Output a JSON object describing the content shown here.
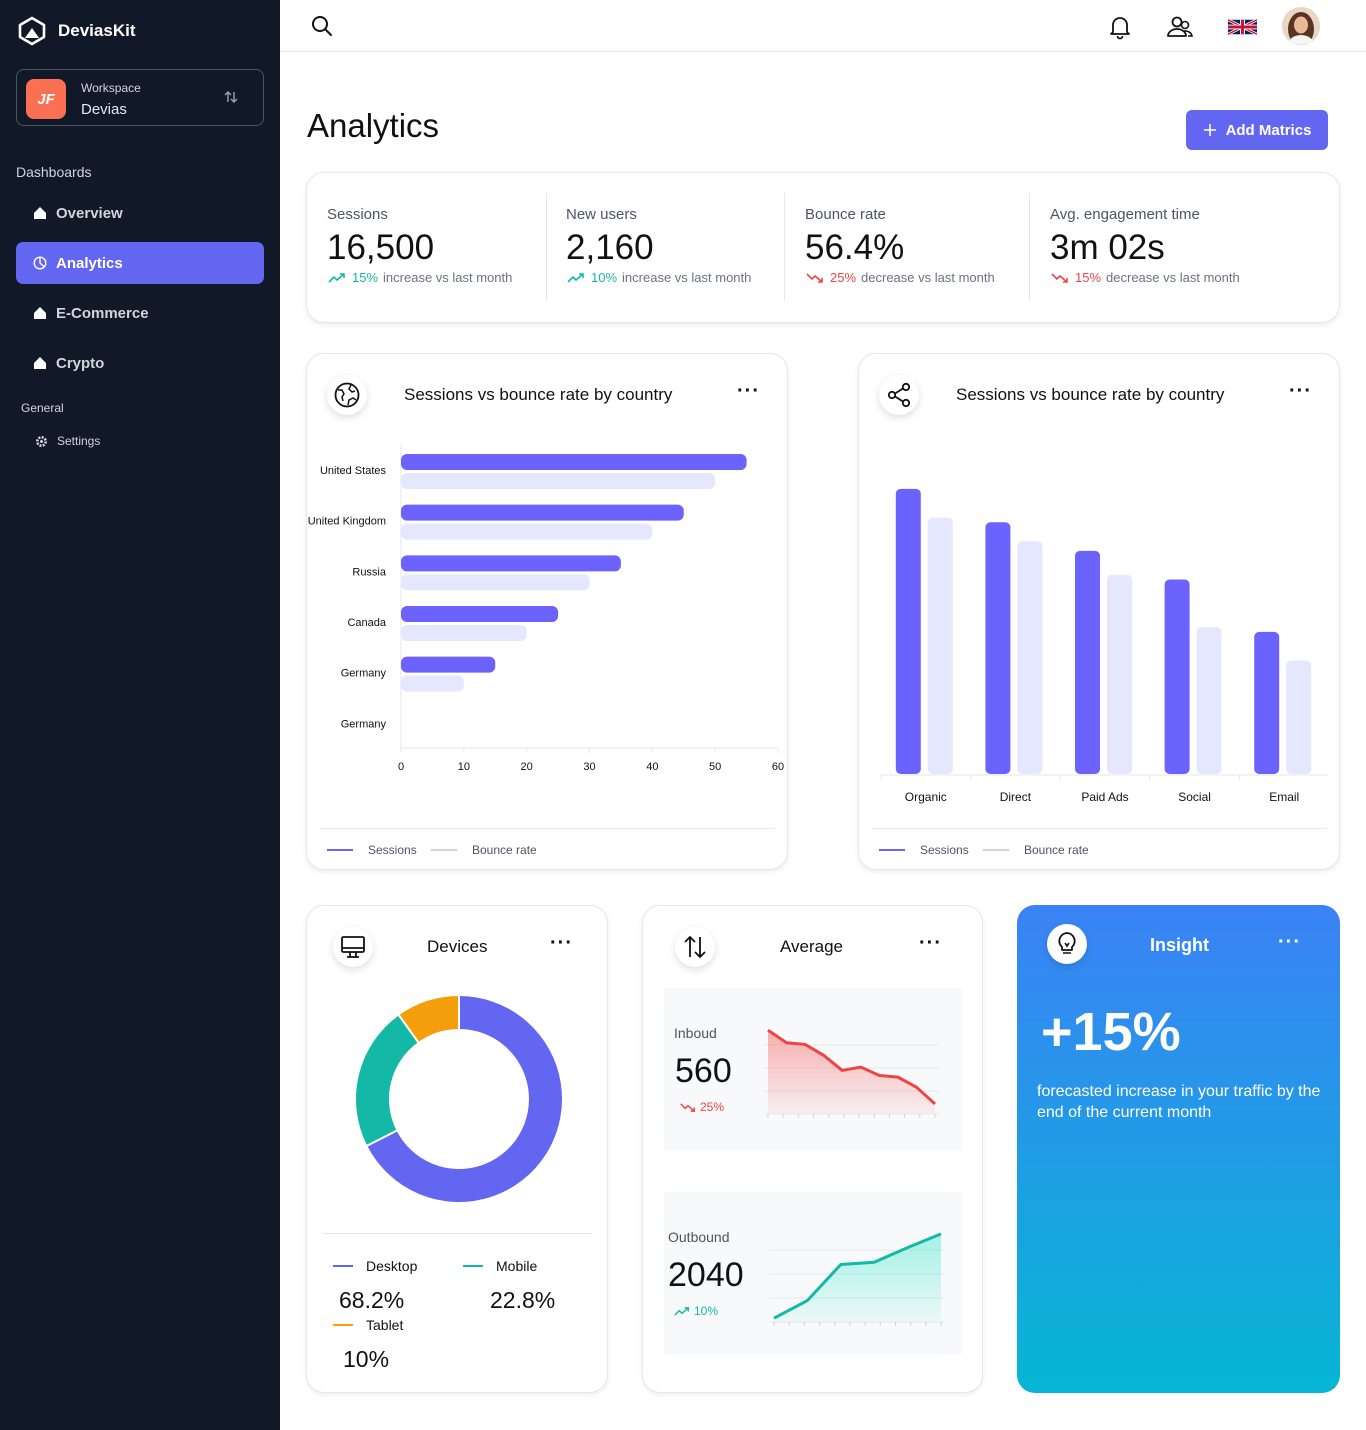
{
  "app": {
    "brand": "DeviasKit"
  },
  "workspace": {
    "label": "Workspace",
    "name": "Devias",
    "logo_text": "JF"
  },
  "sidebar": {
    "section_dashboards": "Dashboards",
    "items": [
      {
        "label": "Overview",
        "icon": "home-icon"
      },
      {
        "label": "Analytics",
        "icon": "pie-chart-icon",
        "active": true
      },
      {
        "label": "E-Commerce",
        "icon": "home-icon"
      },
      {
        "label": "Crypto",
        "icon": "home-icon"
      }
    ],
    "section_general": "General",
    "general_items": [
      {
        "label": "Settings",
        "icon": "gear-icon"
      }
    ]
  },
  "topbar": {
    "icons": [
      "search-icon",
      "bell-icon",
      "users-icon",
      "uk-flag-icon",
      "avatar"
    ]
  },
  "page": {
    "title": "Analytics",
    "add_button": "Add Matrics"
  },
  "stats": [
    {
      "label": "Sessions",
      "value": "16,500",
      "change": "15%",
      "change_text": "increase vs last month",
      "trend": "up"
    },
    {
      "label": "New users",
      "value": "2,160",
      "change": "10%",
      "change_text": "increase vs last month",
      "trend": "up"
    },
    {
      "label": "Bounce rate",
      "value": "56.4%",
      "change": "25%",
      "change_text": "decrease vs last month",
      "trend": "down"
    },
    {
      "label": "Avg. engagement time",
      "value": "3m 02s",
      "change": "15%",
      "change_text": "decrease vs last month",
      "trend": "down"
    }
  ],
  "country_card": {
    "title": "Sessions vs bounce rate by country",
    "legend": [
      "Sessions",
      "Bounce rate"
    ]
  },
  "channel_card": {
    "title": "Sessions vs bounce rate by country",
    "legend": [
      "Sessions",
      "Bounce rate"
    ]
  },
  "devices": {
    "title": "Devices",
    "items": [
      {
        "label": "Desktop",
        "value": "68.2%",
        "color": "#6366f1"
      },
      {
        "label": "Mobile",
        "value": "22.8%",
        "color": "#14b8a6"
      },
      {
        "label": "Tablet",
        "value": "10%",
        "color": "#f59e0b"
      }
    ]
  },
  "average": {
    "title": "Average",
    "inbound": {
      "label": "Inboud",
      "value": "560",
      "change": "25%"
    },
    "outbound": {
      "label": "Outbound",
      "value": "2040",
      "change": "10%"
    }
  },
  "insight": {
    "title": "Insight",
    "value": "+15%",
    "text": "forecasted increase in your traffic by the end of the current month"
  },
  "chart_data": [
    {
      "type": "bar",
      "orientation": "horizontal",
      "categories": [
        "United States",
        "United Kingdom",
        "Russia",
        "Canada",
        "Germany",
        "Germany"
      ],
      "series": [
        {
          "name": "Sessions",
          "values": [
            55,
            45,
            35,
            25,
            15,
            0
          ],
          "color": "#6c63ff"
        },
        {
          "name": "Bounce rate",
          "values": [
            50,
            40,
            30,
            20,
            10,
            0
          ],
          "color": "#e5e7ff"
        }
      ],
      "xlim": [
        0,
        60
      ],
      "xticks": [
        0,
        10,
        20,
        30,
        40,
        50,
        60
      ]
    },
    {
      "type": "bar",
      "categories": [
        "Organic",
        "Direct",
        "Paid Ads",
        "Social",
        "Email"
      ],
      "series": [
        {
          "name": "Sessions",
          "values": [
            60,
            53,
            47,
            41,
            30
          ],
          "color": "#6c63ff"
        },
        {
          "name": "Bounce rate",
          "values": [
            54,
            49,
            42,
            31,
            24
          ],
          "color": "#e5e7ff"
        }
      ],
      "ylim": [
        0,
        65
      ]
    },
    {
      "type": "pie",
      "labels": [
        "Desktop",
        "Mobile",
        "Tablet"
      ],
      "values": [
        68.2,
        22.8,
        10
      ],
      "colors": [
        "#6366f1",
        "#14b8a6",
        "#f59e0b"
      ]
    },
    {
      "type": "area",
      "name": "Inboud",
      "values": [
        10,
        8.5,
        8.3,
        7,
        5.2,
        5.6,
        4.6,
        4.4,
        3.2,
        1.2
      ],
      "ylim": [
        0,
        10.5
      ],
      "color": "#ef4444"
    },
    {
      "type": "area",
      "name": "Outbound",
      "values": [
        0.5,
        2.8,
        7.5,
        7.8,
        9.7,
        11.5
      ],
      "ylim": [
        0,
        12
      ],
      "color": "#14b8a6"
    }
  ]
}
